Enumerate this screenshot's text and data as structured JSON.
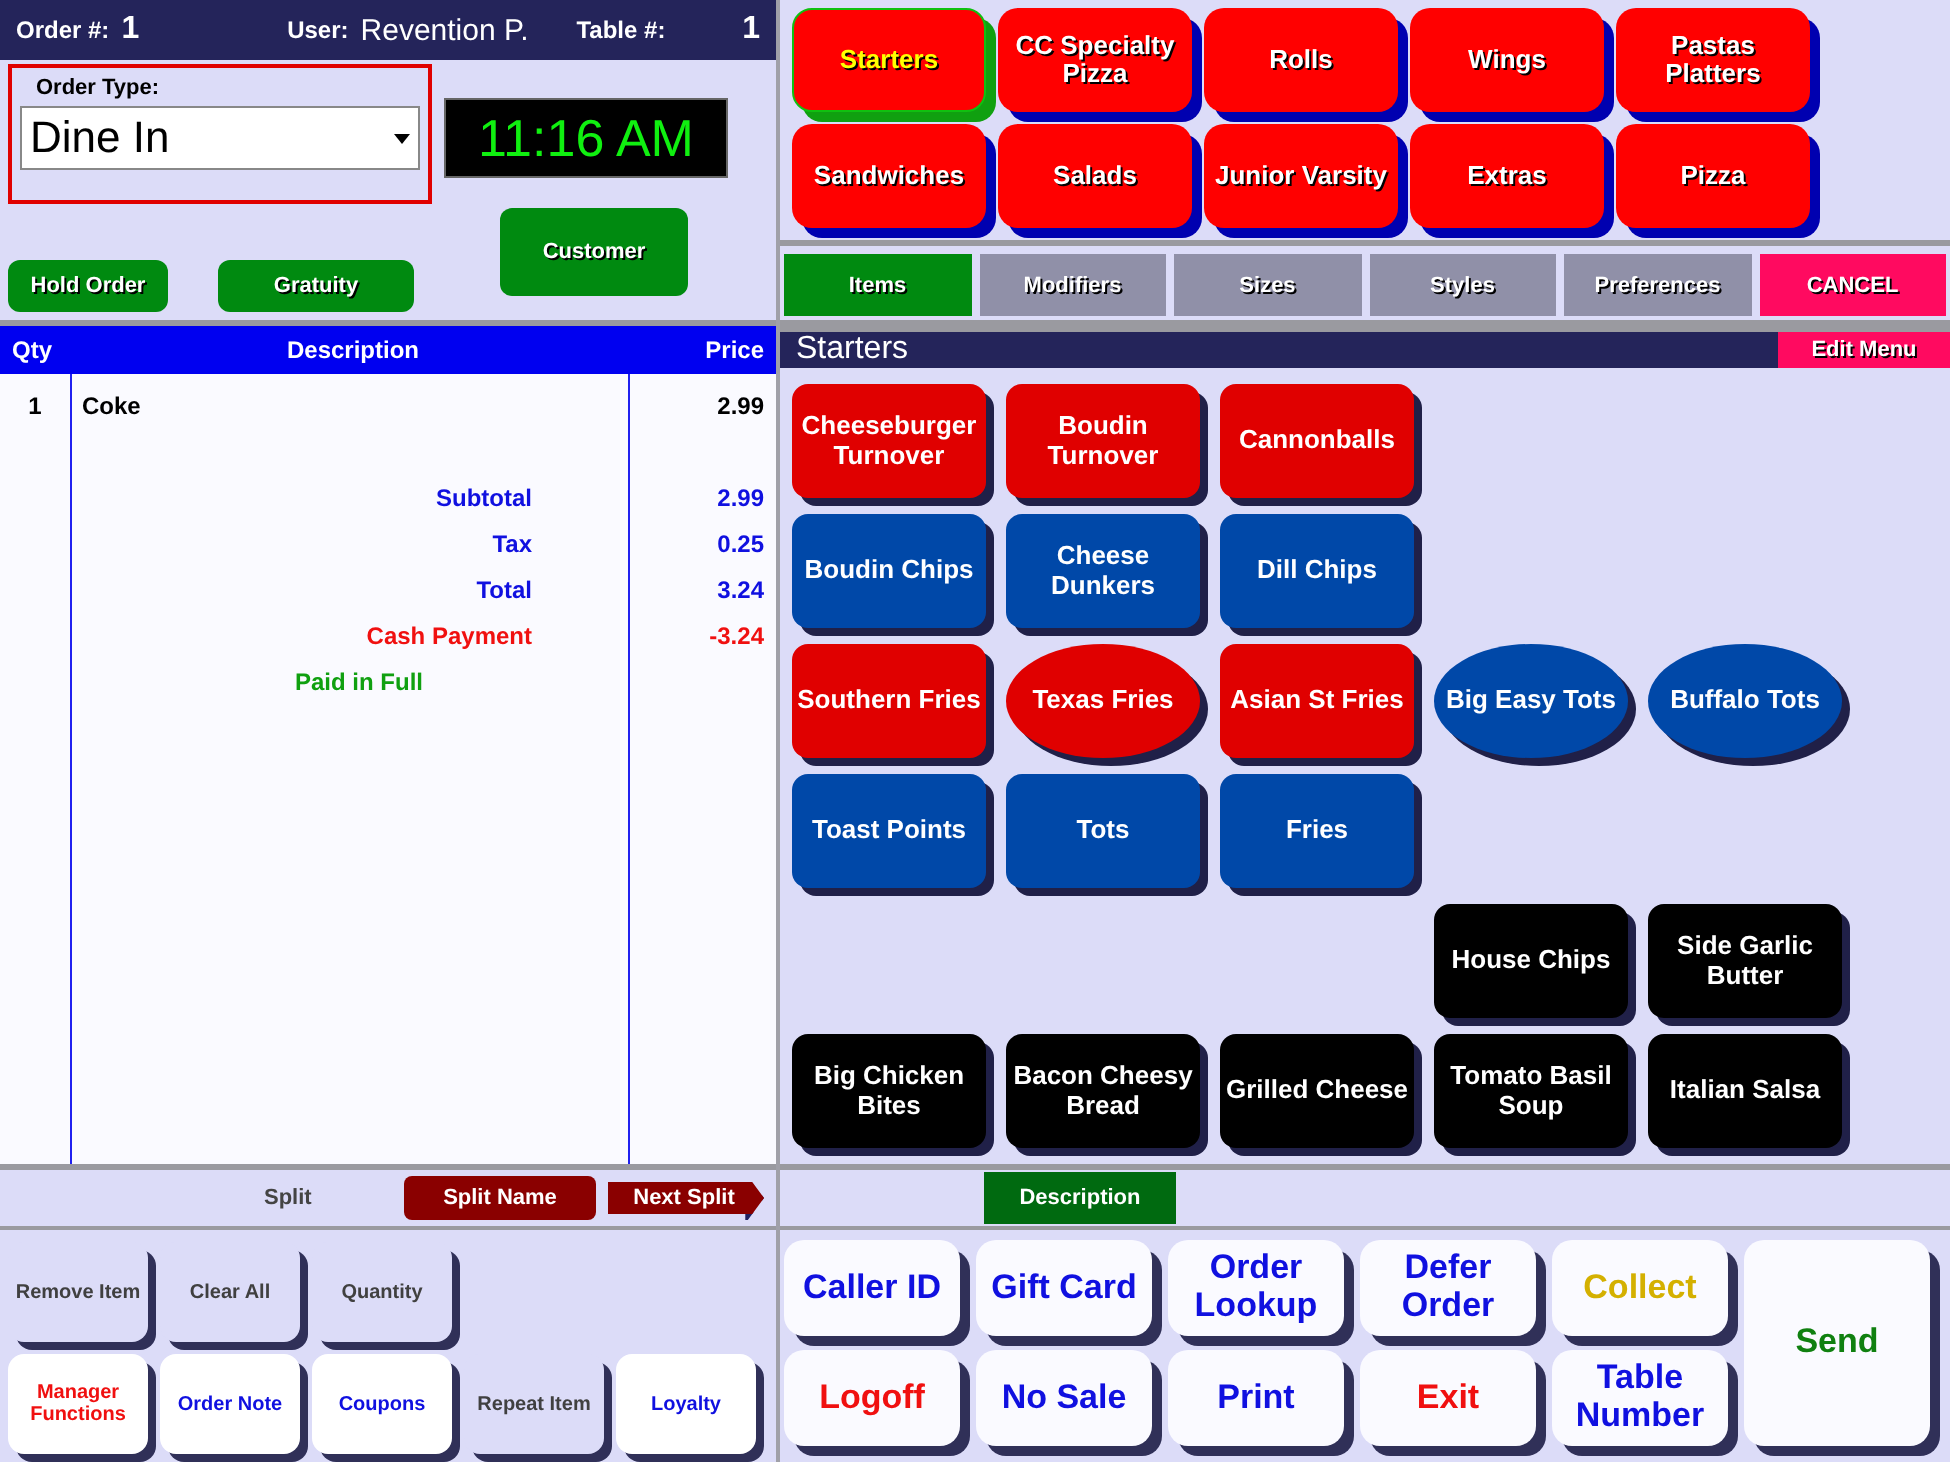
{
  "header": {
    "order_label": "Order #:",
    "order_number": "1",
    "user_label": "User:",
    "user_name": "Revention P.",
    "table_label": "Table #:",
    "table_number": "1"
  },
  "order_type": {
    "label": "Order Type:",
    "value": "Dine In",
    "clock": "11:16 AM"
  },
  "order_buttons": [
    "Hold Order",
    "Gratuity",
    "Customer"
  ],
  "ticket": {
    "columns": [
      "Qty",
      "Description",
      "Price"
    ],
    "items": [
      {
        "qty": "1",
        "description": "Coke",
        "price": "2.99"
      }
    ],
    "summary": [
      {
        "label": "Subtotal",
        "amount": "2.99",
        "color": "#1010e0"
      },
      {
        "label": "Tax",
        "amount": "0.25",
        "color": "#1010e0"
      },
      {
        "label": "Total",
        "amount": "3.24",
        "color": "#1010e0"
      },
      {
        "label": "Cash Payment",
        "amount": "-3.24",
        "color": "#f01010"
      },
      {
        "label": "Paid in Full",
        "color": "#10a010"
      }
    ]
  },
  "split_bar": {
    "label": "Split",
    "split_name": "Split Name",
    "next_split": "Next Split"
  },
  "action_rows": [
    [
      {
        "label": "Remove Item",
        "disabled": true,
        "color": "#404040"
      },
      {
        "label": "Clear All",
        "disabled": true,
        "color": "#404040"
      },
      {
        "label": "Quantity",
        "disabled": true,
        "color": "#404040"
      }
    ],
    [
      {
        "label": "Manager Functions",
        "disabled": false,
        "color": "#f01010"
      },
      {
        "label": "Order Note",
        "disabled": false,
        "color": "#1010e0"
      },
      {
        "label": "Coupons",
        "disabled": false,
        "color": "#1010e0"
      },
      {
        "label": "Repeat Item",
        "disabled": true,
        "color": "#404040"
      },
      {
        "label": "Loyalty",
        "disabled": false,
        "color": "#1010e0"
      }
    ]
  ],
  "categories": [
    {
      "label": "Starters",
      "selected": true
    },
    {
      "label": "CC Specialty Pizza",
      "selected": false
    },
    {
      "label": "Rolls",
      "selected": false
    },
    {
      "label": "Wings",
      "selected": false
    },
    {
      "label": "Pastas Platters",
      "selected": false
    },
    {
      "label": "Sandwiches",
      "selected": false
    },
    {
      "label": "Salads",
      "selected": false
    },
    {
      "label": "Junior Varsity",
      "selected": false
    },
    {
      "label": "Extras",
      "selected": false
    },
    {
      "label": "Pizza",
      "selected": false
    }
  ],
  "tabs": [
    {
      "label": "Items",
      "selected": true
    },
    {
      "label": "Modifiers",
      "selected": false
    },
    {
      "label": "Sizes",
      "selected": false
    },
    {
      "label": "Styles",
      "selected": false
    },
    {
      "label": "Preferences",
      "selected": false
    }
  ],
  "cancel_button": "CANCEL",
  "menu_title": "Starters",
  "edit_menu_button": "Edit Menu",
  "menu_rows": [
    [
      {
        "kind": "rect",
        "label": "Cheeseburger Turnover",
        "color": "#e00000"
      },
      {
        "kind": "rect",
        "label": "Boudin Turnover",
        "color": "#e00000"
      },
      {
        "kind": "rect",
        "label": "Cannonballs",
        "color": "#e00000"
      },
      {
        "kind": "blank"
      },
      {
        "kind": "blank"
      }
    ],
    [
      {
        "kind": "rect",
        "label": "Boudin Chips",
        "color": "#0048a8"
      },
      {
        "kind": "rect",
        "label": "Cheese Dunkers",
        "color": "#0048a8"
      },
      {
        "kind": "rect",
        "label": "Dill Chips",
        "color": "#0048a8"
      },
      {
        "kind": "blank"
      },
      {
        "kind": "blank"
      }
    ],
    [
      {
        "kind": "rect",
        "label": "Southern Fries",
        "color": "#e00000"
      },
      {
        "kind": "oval",
        "label": "Texas Fries",
        "color": "#e00000"
      },
      {
        "kind": "rect",
        "label": "Asian St Fries",
        "color": "#e00000"
      },
      {
        "kind": "oval",
        "label": "Big Easy Tots",
        "color": "#0048a8"
      },
      {
        "kind": "oval",
        "label": "Buffalo Tots",
        "color": "#0048a8"
      }
    ],
    [
      {
        "kind": "rect",
        "label": "Toast Points",
        "color": "#0048a8"
      },
      {
        "kind": "rect",
        "label": "Tots",
        "color": "#0048a8"
      },
      {
        "kind": "rect",
        "label": "Fries",
        "color": "#0048a8"
      },
      {
        "kind": "blank"
      },
      {
        "kind": "blank"
      }
    ],
    [
      {
        "kind": "blank"
      },
      {
        "kind": "blank"
      },
      {
        "kind": "blank"
      },
      {
        "kind": "rect",
        "label": "House Chips",
        "color": "#000000"
      },
      {
        "kind": "rect",
        "label": "Side Garlic Butter",
        "color": "#000000"
      }
    ],
    [
      {
        "kind": "rect",
        "label": "Big Chicken Bites",
        "color": "#000000"
      },
      {
        "kind": "rect",
        "label": "Bacon Cheesy Bread",
        "color": "#000000"
      },
      {
        "kind": "rect",
        "label": "Grilled Cheese",
        "color": "#000000"
      },
      {
        "kind": "rect",
        "label": "Tomato Basil Soup",
        "color": "#000000"
      },
      {
        "kind": "rect",
        "label": "Italian Salsa",
        "color": "#000000"
      }
    ]
  ],
  "description_tab": "Description",
  "function_buttons": [
    {
      "label": "Caller ID",
      "color": "#1010e0"
    },
    {
      "label": "Gift Card",
      "color": "#1010e0"
    },
    {
      "label": "Order Lookup",
      "color": "#1010e0"
    },
    {
      "label": "Defer Order",
      "color": "#1010e0"
    },
    {
      "label": "Collect",
      "color": "#d4b000"
    },
    {
      "label": "Logoff",
      "color": "#f01010"
    },
    {
      "label": "No Sale",
      "color": "#1010e0"
    },
    {
      "label": "Print",
      "color": "#1010e0"
    },
    {
      "label": "Exit",
      "color": "#f01010"
    },
    {
      "label": "Table Number",
      "color": "#1010e0"
    }
  ],
  "send_button": {
    "label": "Send",
    "color": "#108010"
  }
}
